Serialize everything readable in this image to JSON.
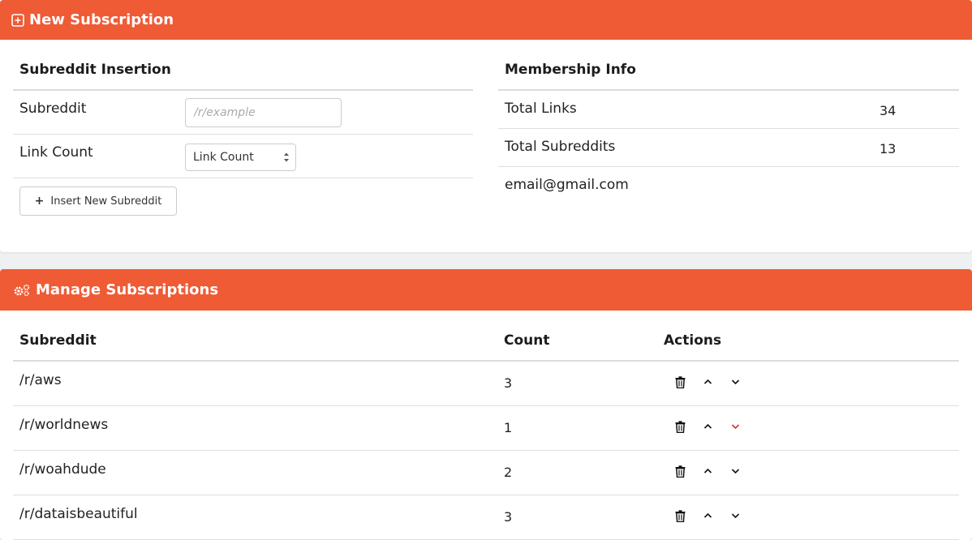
{
  "new_subscription": {
    "header_title": "New Subscription",
    "header_icon": "plus-square-icon",
    "insertion": {
      "title": "Subreddit Insertion",
      "subreddit_label": "Subreddit",
      "subreddit_placeholder": "/r/example",
      "link_count_label": "Link Count",
      "link_count_selected": "Link Count",
      "insert_button_label": "Insert New Subreddit",
      "insert_button_icon": "plus-icon"
    },
    "membership": {
      "title": "Membership Info",
      "rows": [
        {
          "label": "Total Links",
          "value": "34"
        },
        {
          "label": "Total Subreddits",
          "value": "13"
        },
        {
          "label": "email@gmail.com",
          "value": ""
        }
      ]
    }
  },
  "manage_subscriptions": {
    "header_title": "Manage Subscriptions",
    "header_icon": "gears-icon",
    "columns": [
      "Subreddit",
      "Count",
      "Actions"
    ],
    "rows": [
      {
        "subreddit": "/r/aws",
        "count": "3"
      },
      {
        "subreddit": "/r/worldnews",
        "count": "1"
      },
      {
        "subreddit": "/r/woahdude",
        "count": "2"
      },
      {
        "subreddit": "/r/dataisbeautiful",
        "count": "3"
      }
    ],
    "action_icons": [
      "trash-icon",
      "chevron-up-icon",
      "chevron-down-icon"
    ]
  },
  "colors": {
    "accent": "#ef5b35",
    "highlight_red": "#e02a2a"
  }
}
